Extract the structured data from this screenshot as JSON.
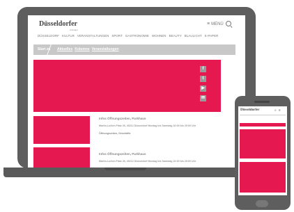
{
  "laptop": {
    "logo": "Düsseldorfer",
    "logo_sub": "Anzeiger",
    "menu_label": "MENÜ",
    "nav_items": [
      "DÜSSELDORF",
      "KULTUR",
      "VERANSTALTUNGEN",
      "SPORT",
      "GASTRONOMIE",
      "WOHNEN",
      "BEAUTY",
      "BLAULICHT",
      "E-PAPER"
    ],
    "breadcrumb": {
      "home": "Start zu",
      "links": [
        "Aktuelles",
        "Kolumne",
        "Veranstaltungen"
      ]
    },
    "social_icons": [
      "facebook-icon",
      "twitter-icon",
      "youtube-icon",
      "mail-icon"
    ],
    "social_glyphs": [
      "f",
      "t",
      "▶",
      "✉"
    ],
    "teasers": [
      {
        "title": "Infos Öffnungszeiten, Parkhaus",
        "address": "Martin-Luther-Platz 26, 40212 Düsseldorf Montag bis Samstag 10:00 bis 20:00 Uhr",
        "caption": "Öffnungszeiten, Geschäfte"
      },
      {
        "title": "Infos Öffnungszeiten, Parkhaus",
        "address": "Martin-Luther-Platz 26, 40212 Düsseldorf Montag bis Samstag 10:00 bis 20:00 Uhr",
        "caption": ""
      }
    ]
  },
  "phone": {
    "logo": "Düsseldorfer",
    "icons": [
      "search-icon",
      "menu-icon"
    ],
    "icon_glyphs": [
      "⌕",
      "≡"
    ]
  },
  "colors": {
    "accent": "#e5194f",
    "device": "#5e5e5e",
    "breadcrumb_bg": "#c8c8c8"
  }
}
